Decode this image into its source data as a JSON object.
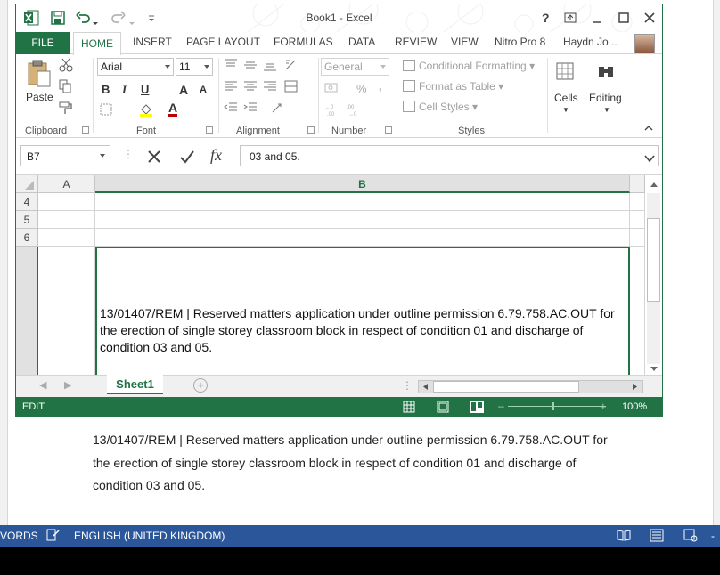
{
  "excel": {
    "title": "Book1 - Excel",
    "help": "?",
    "tabs": {
      "file": "FILE",
      "home": "HOME",
      "insert": "INSERT",
      "page_layout": "PAGE LAYOUT",
      "formulas": "FORMULAS",
      "data": "DATA",
      "review": "REVIEW",
      "view": "VIEW",
      "nitro": "Nitro Pro 8",
      "user": "Haydn Jo..."
    },
    "ribbon": {
      "paste_label": "Paste",
      "font_name": "Arial",
      "font_size": "11",
      "bold": "B",
      "italic": "I",
      "underline": "U",
      "grow": "A",
      "shrink": "A",
      "font_color": "A",
      "number_format": "General",
      "percent": "%",
      "comma": ",",
      "conditional_formatting": "Conditional Formatting",
      "format_as_table": "Format as Table",
      "cell_styles": "Cell Styles",
      "cells": "Cells",
      "editing": "Editing",
      "groups": {
        "clipboard": "Clipboard",
        "font": "Font",
        "alignment": "Alignment",
        "number": "Number",
        "styles": "Styles"
      }
    },
    "formula_bar": {
      "name_box": "B7",
      "fx": "fx",
      "formula": "03 and 05."
    },
    "grid": {
      "columns": [
        "A",
        "B"
      ],
      "rows": [
        "4",
        "5",
        "6",
        ""
      ],
      "cell_b7": "13/01407/REM | Reserved matters application under outline permission 6.79.758.AC.OUT for the erection of single storey classroom block in respect of condition 01 and discharge of condition 03 and 05."
    },
    "sheet_tab": "Sheet1",
    "add_sheet": "+",
    "status": {
      "mode": "EDIT",
      "zoom": "100%"
    }
  },
  "word": {
    "body": "13/01407/REM | Reserved matters application under outline permission 6.79.758.AC.OUT for the erection of single storey classroom block in respect of condition 01 and discharge of condition 03 and 05.",
    "status": {
      "words": "VORDS",
      "language": "ENGLISH (UNITED KINGDOM)",
      "minus": "-"
    }
  },
  "colors": {
    "excel_green": "#217346",
    "word_blue": "#2b579a",
    "font_red": "#c00000"
  }
}
